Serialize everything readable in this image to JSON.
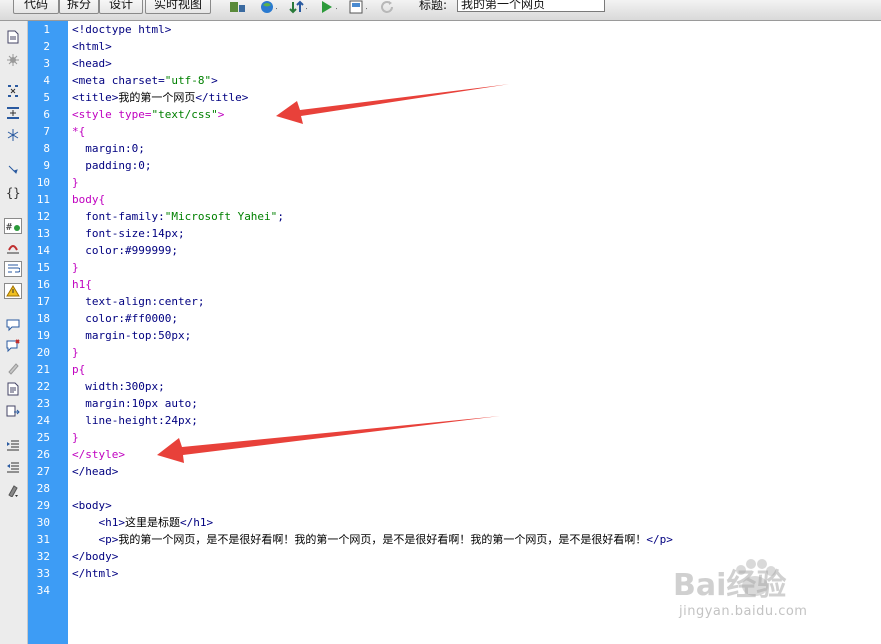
{
  "toolbar": {
    "code_label": "代码",
    "split_label": "拆分",
    "design_label": "设计",
    "live_view_label": "实时视图",
    "title_label": "标题:",
    "title_value": "我的第一个网页",
    "icons": [
      "inspect-icon",
      "browser-preview-icon",
      "file-transfer-icon",
      "debug-icon",
      "visual-aids-icon",
      "refresh-icon"
    ]
  },
  "left_tools": [
    "open-documents-icon",
    "show-code-navigator-icon",
    "collapse-full-tag-icon",
    "collapse-selection-icon",
    "expand-all-icon",
    "select-parent-tag-icon",
    "balance-braces-icon",
    "line-numbers-icon",
    "highlight-invalid-code-icon",
    "word-wrap-icon",
    "syntax-error-alerts-icon",
    "apply-comment-icon",
    "remove-comment-icon",
    "wrap-tag-icon",
    "recent-snippets-icon",
    "move-css-icon",
    "indent-code-icon",
    "outdent-code-icon",
    "format-source-code-icon"
  ],
  "line_numbers": [
    "1",
    "2",
    "3",
    "4",
    "5",
    "6",
    "7",
    "8",
    "9",
    "10",
    "11",
    "12",
    "13",
    "14",
    "15",
    "16",
    "17",
    "18",
    "19",
    "20",
    "21",
    "22",
    "23",
    "24",
    "25",
    "26",
    "27",
    "28",
    "29",
    "30",
    "31",
    "32",
    "33",
    "34"
  ],
  "code": {
    "l1": "<!doctype html>",
    "l2": "<html>",
    "l3": "<head>",
    "l4a": "<meta charset=",
    "l4b": "\"utf-8\"",
    "l4c": ">",
    "l5a": "<title>",
    "l5b": "我的第一个网页",
    "l5c": "</title>",
    "l6a": "<style type=",
    "l6b": "\"text/css\"",
    "l6c": ">",
    "l7": "*{",
    "l8a": "  margin:",
    "l8b": "0;",
    "l9a": "  padding:",
    "l9b": "0;",
    "l10": "}",
    "l11": "body{",
    "l12a": "  font-family:",
    "l12b": "\"Microsoft Yahei\"",
    "l12c": ";",
    "l13a": "  font-size:",
    "l13b": "14px;",
    "l14a": "  color:",
    "l14b": "#999999;",
    "l15": "}",
    "l16": "h1{",
    "l17a": "  text-align:",
    "l17b": "center;",
    "l18a": "  color:",
    "l18b": "#ff0000;",
    "l19a": "  margin-top:",
    "l19b": "50px;",
    "l20": "}",
    "l21": "p{",
    "l22a": "  width:",
    "l22b": "300px;",
    "l23a": "  margin:",
    "l23b": "10px auto;",
    "l24a": "  line-height:",
    "l24b": "24px;",
    "l25": "}",
    "l26": "</style>",
    "l27": "</head>",
    "l29": "<body>",
    "l30a": "    <h1>",
    "l30b": "这里是标题",
    "l30c": "</h1>",
    "l31a": "    <p>",
    "l31b": "我的第一个网页，是不是很好看啊！我的第一个网页，是不是很好看啊！我的第一个网页，是不是很好看啊！",
    "l31c": "</p>",
    "l32": "</body>",
    "l33": "</html>"
  },
  "colors": {
    "gutter": "#3d9cf5",
    "tag": "#000080",
    "css": "#c000c0",
    "string": "#008000",
    "arrow": "#e8413a"
  },
  "watermark": {
    "brand": "Bai经验",
    "url": "jingyan.baidu.com"
  }
}
